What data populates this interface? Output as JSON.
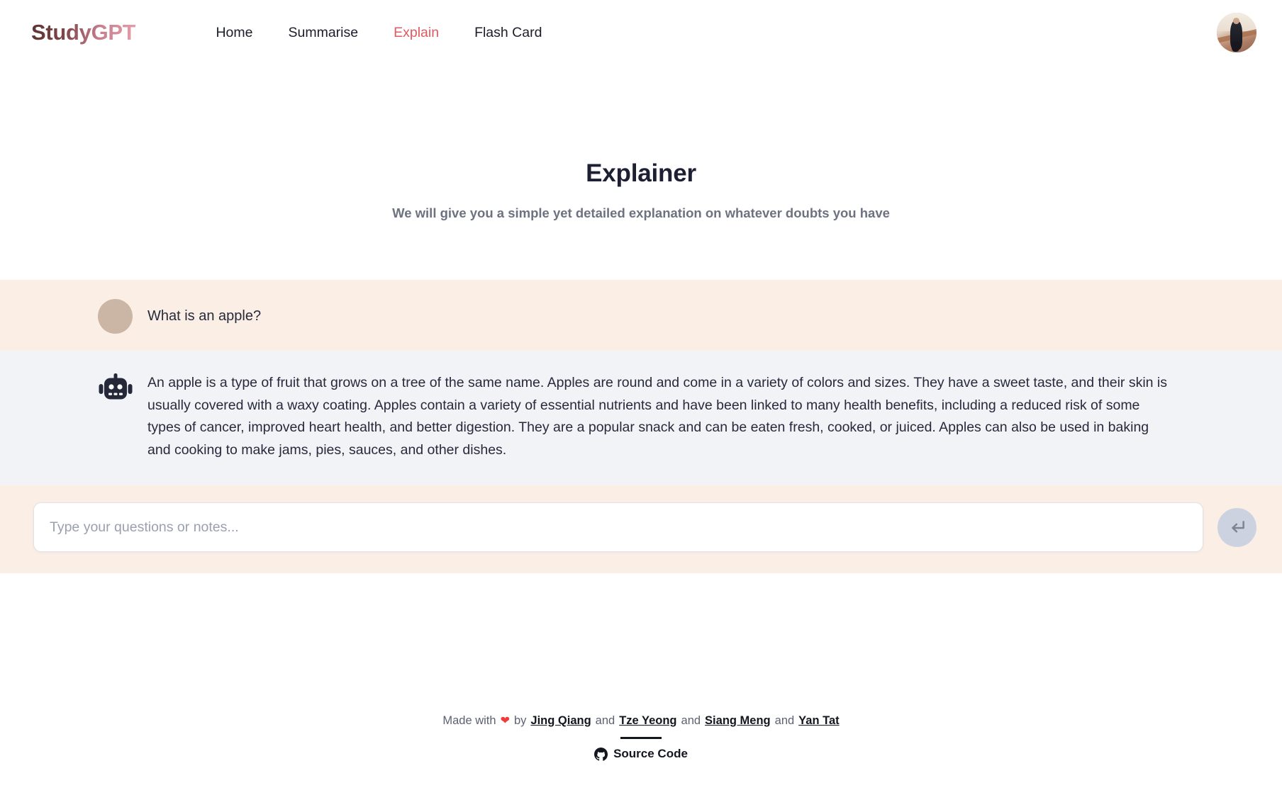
{
  "brand": {
    "name": "StudyGPT"
  },
  "nav": {
    "items": [
      {
        "label": "Home",
        "active": false
      },
      {
        "label": "Summarise",
        "active": false
      },
      {
        "label": "Explain",
        "active": true
      },
      {
        "label": "Flash Card",
        "active": false
      }
    ],
    "avatar_icon": "user-avatar-photo"
  },
  "hero": {
    "title": "Explainer",
    "subtitle": "We will give you a simple yet detailed explanation on whatever doubts you have"
  },
  "chat": {
    "user_message": {
      "avatar_icon": "user-avatar-photo",
      "text": "What is an apple?"
    },
    "bot_message": {
      "avatar_icon": "robot-icon",
      "text": "An apple is a type of fruit that grows on a tree of the same name. Apples are round and come in a variety of colors and sizes. They have a sweet taste, and their skin is usually covered with a waxy coating. Apples contain a variety of essential nutrients and have been linked to many health benefits, including a reduced risk of some types of cancer, improved heart health, and better digestion. They are a popular snack and can be eaten fresh, cooked, or juiced. Apples can also be used in baking and cooking to make jams, pies, sauces, and other dishes."
    }
  },
  "composer": {
    "placeholder": "Type your questions or notes...",
    "value": "",
    "send_icon": "enter-return-arrow-icon"
  },
  "footer": {
    "made_with": "Made with",
    "heart": "❤",
    "by": "by",
    "authors": [
      "Jing Qiang",
      "Tze Yeong",
      "Siang Meng",
      "Yan Tat"
    ],
    "conjunction": "and",
    "source_label": "Source Code",
    "source_icon": "github-icon"
  },
  "colors": {
    "brand_start": "#5c3434",
    "brand_end": "#e79daa",
    "nav_active": "#e0595f",
    "user_row_bg": "#fbeee5",
    "bot_row_bg": "#f1f3f6",
    "text_dark": "#262a3c",
    "text_muted": "#6d7280",
    "send_btn_bg": "#ccd2df",
    "heart": "#ef3b3b"
  }
}
